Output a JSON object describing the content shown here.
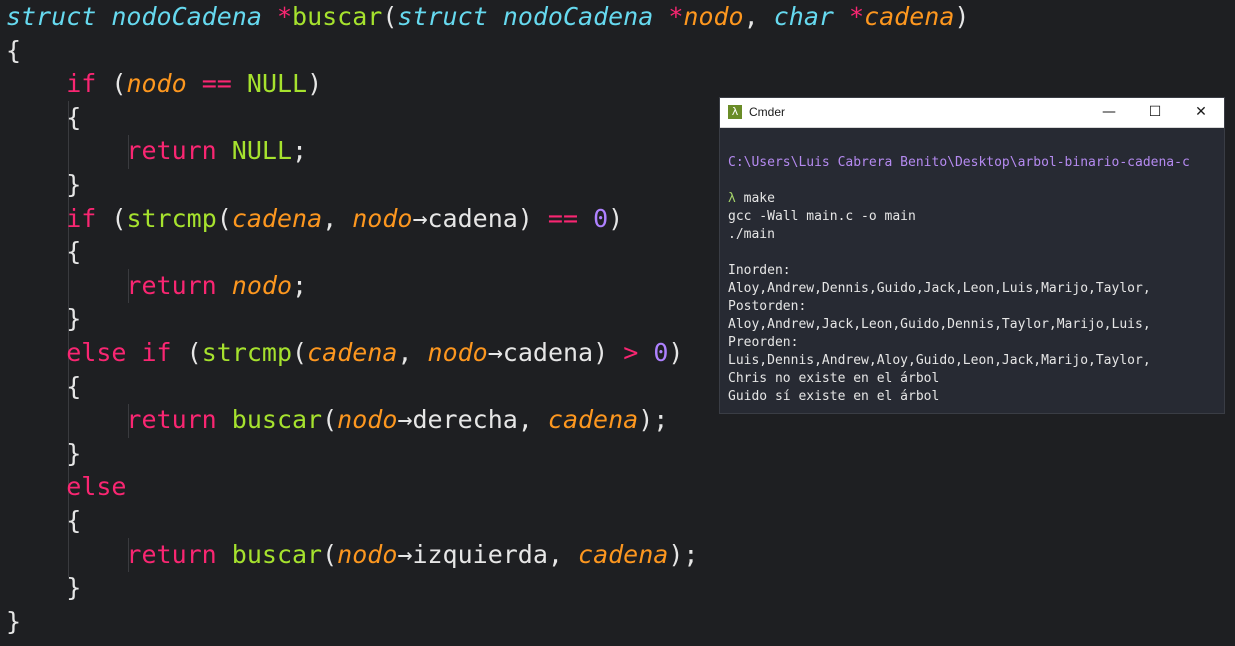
{
  "editor": {
    "lines": [
      [
        {
          "t": "struct",
          "c": "tk-type"
        },
        {
          "t": " ",
          "c": "tk-plain"
        },
        {
          "t": "nodoCadena",
          "c": "tk-type"
        },
        {
          "t": " ",
          "c": "tk-plain"
        },
        {
          "t": "*",
          "c": "tk-op"
        },
        {
          "t": "buscar",
          "c": "tk-fn"
        },
        {
          "t": "(",
          "c": "tk-plain"
        },
        {
          "t": "struct",
          "c": "tk-type"
        },
        {
          "t": " ",
          "c": "tk-plain"
        },
        {
          "t": "nodoCadena",
          "c": "tk-type"
        },
        {
          "t": " ",
          "c": "tk-plain"
        },
        {
          "t": "*",
          "c": "tk-op"
        },
        {
          "t": "nodo",
          "c": "tk-par"
        },
        {
          "t": ", ",
          "c": "tk-plain"
        },
        {
          "t": "char",
          "c": "tk-type"
        },
        {
          "t": " ",
          "c": "tk-plain"
        },
        {
          "t": "*",
          "c": "tk-op"
        },
        {
          "t": "cadena",
          "c": "tk-par"
        },
        {
          "t": ")",
          "c": "tk-plain"
        }
      ],
      [
        {
          "t": "{",
          "c": "tk-plain"
        }
      ],
      [
        {
          "t": "    ",
          "c": "tk-plain"
        },
        {
          "t": "if",
          "c": "tk-kw"
        },
        {
          "t": " (",
          "c": "tk-plain"
        },
        {
          "t": "nodo",
          "c": "tk-par"
        },
        {
          "t": " ",
          "c": "tk-plain"
        },
        {
          "t": "==",
          "c": "tk-op"
        },
        {
          "t": " ",
          "c": "tk-plain"
        },
        {
          "t": "NULL",
          "c": "tk-const"
        },
        {
          "t": ")",
          "c": "tk-plain"
        }
      ],
      [
        {
          "t": "    {",
          "c": "tk-plain"
        }
      ],
      [
        {
          "t": "        ",
          "c": "tk-plain"
        },
        {
          "t": "return",
          "c": "tk-kw"
        },
        {
          "t": " ",
          "c": "tk-plain"
        },
        {
          "t": "NULL",
          "c": "tk-const"
        },
        {
          "t": ";",
          "c": "tk-plain"
        }
      ],
      [
        {
          "t": "    }",
          "c": "tk-plain"
        }
      ],
      [
        {
          "t": "    ",
          "c": "tk-plain"
        },
        {
          "t": "if",
          "c": "tk-kw"
        },
        {
          "t": " (",
          "c": "tk-plain"
        },
        {
          "t": "strcmp",
          "c": "tk-fn"
        },
        {
          "t": "(",
          "c": "tk-plain"
        },
        {
          "t": "cadena",
          "c": "tk-par"
        },
        {
          "t": ", ",
          "c": "tk-plain"
        },
        {
          "t": "nodo",
          "c": "tk-par"
        },
        {
          "t": "→cadena) ",
          "c": "tk-plain"
        },
        {
          "t": "==",
          "c": "tk-op"
        },
        {
          "t": " ",
          "c": "tk-plain"
        },
        {
          "t": "0",
          "c": "tk-num"
        },
        {
          "t": ")",
          "c": "tk-plain"
        }
      ],
      [
        {
          "t": "    {",
          "c": "tk-plain"
        }
      ],
      [
        {
          "t": "        ",
          "c": "tk-plain"
        },
        {
          "t": "return",
          "c": "tk-kw"
        },
        {
          "t": " ",
          "c": "tk-plain"
        },
        {
          "t": "nodo",
          "c": "tk-par"
        },
        {
          "t": ";",
          "c": "tk-plain"
        }
      ],
      [
        {
          "t": "    }",
          "c": "tk-plain"
        }
      ],
      [
        {
          "t": "    ",
          "c": "tk-plain"
        },
        {
          "t": "else",
          "c": "tk-kw"
        },
        {
          "t": " ",
          "c": "tk-plain"
        },
        {
          "t": "if",
          "c": "tk-kw"
        },
        {
          "t": " (",
          "c": "tk-plain"
        },
        {
          "t": "strcmp",
          "c": "tk-fn"
        },
        {
          "t": "(",
          "c": "tk-plain"
        },
        {
          "t": "cadena",
          "c": "tk-par"
        },
        {
          "t": ", ",
          "c": "tk-plain"
        },
        {
          "t": "nodo",
          "c": "tk-par"
        },
        {
          "t": "→cadena) ",
          "c": "tk-plain"
        },
        {
          "t": ">",
          "c": "tk-op"
        },
        {
          "t": " ",
          "c": "tk-plain"
        },
        {
          "t": "0",
          "c": "tk-num"
        },
        {
          "t": ")",
          "c": "tk-plain"
        }
      ],
      [
        {
          "t": "    {",
          "c": "tk-plain"
        }
      ],
      [
        {
          "t": "        ",
          "c": "tk-plain"
        },
        {
          "t": "return",
          "c": "tk-kw"
        },
        {
          "t": " ",
          "c": "tk-plain"
        },
        {
          "t": "buscar",
          "c": "tk-fn"
        },
        {
          "t": "(",
          "c": "tk-plain"
        },
        {
          "t": "nodo",
          "c": "tk-par"
        },
        {
          "t": "→derecha, ",
          "c": "tk-plain"
        },
        {
          "t": "cadena",
          "c": "tk-par"
        },
        {
          "t": ");",
          "c": "tk-plain"
        }
      ],
      [
        {
          "t": "    }",
          "c": "tk-plain"
        }
      ],
      [
        {
          "t": "    ",
          "c": "tk-plain"
        },
        {
          "t": "else",
          "c": "tk-kw"
        }
      ],
      [
        {
          "t": "    {",
          "c": "tk-plain"
        }
      ],
      [
        {
          "t": "        ",
          "c": "tk-plain"
        },
        {
          "t": "return",
          "c": "tk-kw"
        },
        {
          "t": " ",
          "c": "tk-plain"
        },
        {
          "t": "buscar",
          "c": "tk-fn"
        },
        {
          "t": "(",
          "c": "tk-plain"
        },
        {
          "t": "nodo",
          "c": "tk-par"
        },
        {
          "t": "→izquierda, ",
          "c": "tk-plain"
        },
        {
          "t": "cadena",
          "c": "tk-par"
        },
        {
          "t": ");",
          "c": "tk-plain"
        }
      ],
      [
        {
          "t": "    }",
          "c": "tk-plain"
        }
      ],
      [
        {
          "t": "}",
          "c": "tk-plain"
        }
      ]
    ]
  },
  "terminal": {
    "title": "Cmder",
    "logo_glyph": "λ",
    "minimize_glyph": "—",
    "maximize_glyph": "☐",
    "close_glyph": "✕",
    "path": "C:\\Users\\Luis Cabrera Benito\\Desktop\\arbol-binario-cadena-c",
    "prompt_symbol": "λ",
    "command": " make",
    "output": [
      "gcc -Wall main.c -o main",
      "./main",
      "",
      "Inorden:",
      "Aloy,Andrew,Dennis,Guido,Jack,Leon,Luis,Marijo,Taylor,",
      "Postorden:",
      "Aloy,Andrew,Jack,Leon,Guido,Dennis,Taylor,Marijo,Luis,",
      "Preorden:",
      "Luis,Dennis,Andrew,Aloy,Guido,Leon,Jack,Marijo,Taylor,",
      "Chris no existe en el árbol",
      "Guido sí existe en el árbol"
    ]
  },
  "colors": {
    "editor_bg": "#1e1f22",
    "keyword": "#f92672",
    "type": "#66d9ef",
    "function": "#a6e22e",
    "parameter": "#fd971f",
    "number": "#ae81ff",
    "terminal_bg": "#272a33",
    "terminal_path": "#b58af0",
    "terminal_prompt": "#a4d36a"
  }
}
